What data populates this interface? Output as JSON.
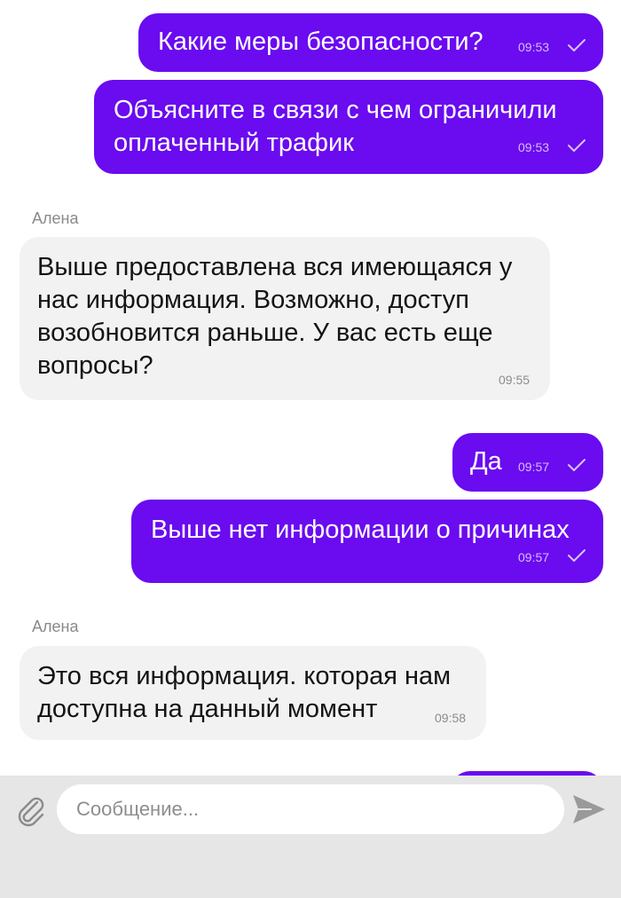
{
  "messages": [
    {
      "direction": "outgoing",
      "text": "Какие меры безопасности?",
      "time": "09:53",
      "read_status": "check-icon"
    },
    {
      "direction": "outgoing",
      "lines": [
        "Объясните в связи с чем ограничили",
        "оплаченный трафик"
      ],
      "time": "09:53",
      "read_status": "check-icon"
    },
    {
      "direction": "incoming",
      "sender": "Алена",
      "lines": [
        "Выше предоставлена вся имеющаяся у",
        "нас информация. Возможно, доступ",
        "возобновится раньше. У вас есть еще",
        "вопросы?"
      ],
      "time": "09:55"
    },
    {
      "direction": "outgoing",
      "text": "Да",
      "time": "09:57",
      "read_status": "check-icon"
    },
    {
      "direction": "outgoing",
      "text": "Выше нет информации о причинах",
      "time": "09:57",
      "read_status": "check-icon"
    },
    {
      "direction": "incoming",
      "sender": "Алена",
      "lines": [
        "Это вся информация. которая нам",
        "доступна на данный момент"
      ],
      "time": "09:58"
    }
  ],
  "composer": {
    "placeholder": "Сообщение...",
    "attach_icon": "paperclip-icon",
    "send_icon": "send-icon"
  },
  "colors": {
    "outgoing_bubble": "#6a0bf0",
    "incoming_bubble": "#f2f2f2",
    "composer_bg": "#e6e6e6"
  }
}
